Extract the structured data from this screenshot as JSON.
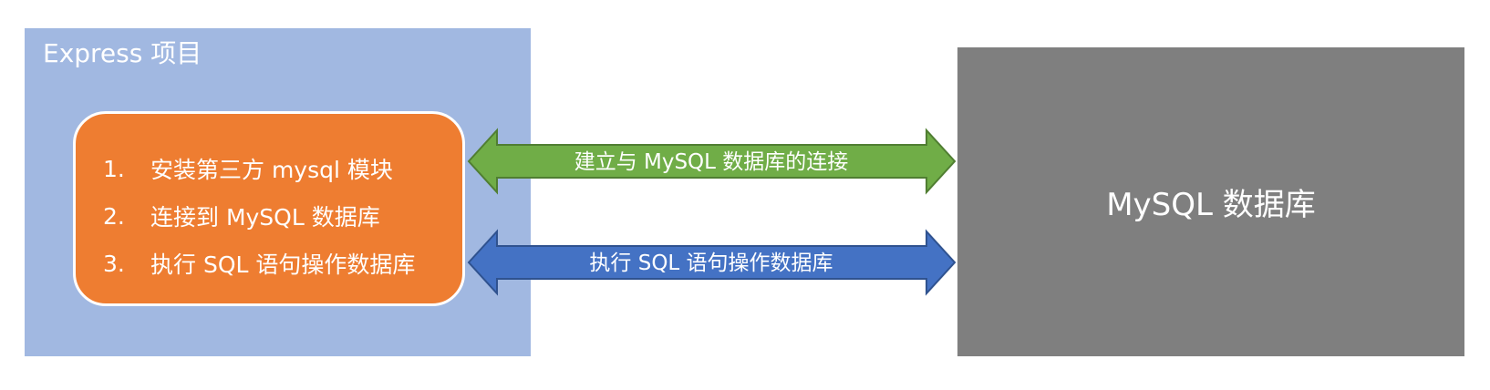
{
  "express": {
    "title": "Express 项目",
    "steps": [
      {
        "num": "1.",
        "text": "安装第三方 mysql 模块"
      },
      {
        "num": "2.",
        "text": "连接到 MySQL 数据库"
      },
      {
        "num": "3.",
        "text": "执行 SQL 语句操作数据库"
      }
    ]
  },
  "arrows": {
    "connect_label": "建立与 MySQL 数据库的连接",
    "execute_label": "执行 SQL 语句操作数据库"
  },
  "database": {
    "label": "MySQL 数据库"
  },
  "colors": {
    "express_bg": "#a1b8e1",
    "steps_bg": "#ee7d31",
    "connect_arrow": "#70ad47",
    "execute_arrow": "#4472c4",
    "database_bg": "#7f7f7f"
  }
}
